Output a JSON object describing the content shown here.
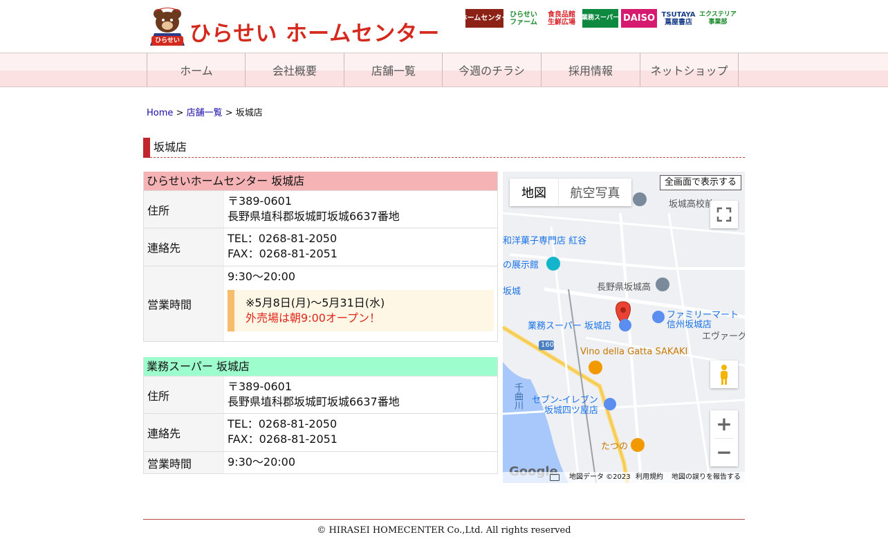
{
  "header": {
    "logo_text": "ひらせい ホームセンター",
    "logo_badge": "ひらせい",
    "banners": [
      {
        "label": "ホームセンター",
        "bg": "#8b2215",
        "color": "#ffffff"
      },
      {
        "label": "ひらせい\nファーム",
        "bg": "#ffffff",
        "color": "#1b8a2b"
      },
      {
        "label": "食良品館\n生鮮広場",
        "bg": "#ffffff",
        "color": "#d8262c"
      },
      {
        "label": "業務スーパー",
        "bg": "#0d8a3f",
        "color": "#ffffff"
      },
      {
        "label": "DAISO",
        "bg": "#d61a6f",
        "color": "#ffffff"
      },
      {
        "label": "TSUTAYA\n蔦屋書店",
        "bg": "#ffffff",
        "color": "#1b3f8a"
      },
      {
        "label": "エクステリア\n事業部",
        "bg": "#ffffff",
        "color": "#1b8a2b"
      }
    ]
  },
  "nav": [
    {
      "label": "ホーム"
    },
    {
      "label": "会社概要"
    },
    {
      "label": "店舗一覧"
    },
    {
      "label": "今週のチラシ"
    },
    {
      "label": "採用情報"
    },
    {
      "label": "ネットショップ"
    }
  ],
  "breadcrumb": {
    "home": "Home",
    "sep1": ">",
    "list": "店舗一覧",
    "sep2": ">",
    "current": "坂城店"
  },
  "page_title": "坂城店",
  "stores": [
    {
      "name": "ひらせいホームセンター 坂城店",
      "head_color": "#f5b3b5",
      "address_label": "住所",
      "postal": "〒389-0601",
      "address": "長野県埴科郡坂城町坂城6637番地",
      "contact_label": "連絡先",
      "tel": "TEL：0268-81-2050",
      "fax": "FAX：0268-81-2051",
      "hours_label": "営業時間",
      "hours": "9:30～20:00",
      "notice_line1": "※5月8日(月)～5月31日(水)",
      "notice_line2": "外売場は朝9:00オープン！"
    },
    {
      "name": "業務スーパー 坂城店",
      "head_color": "#9dfdcd",
      "address_label": "住所",
      "postal": "〒389-0601",
      "address": "長野県埴科郡坂城町坂城6637番地",
      "contact_label": "連絡先",
      "tel": "TEL：0268-81-2050",
      "fax": "FAX：0268-81-2051",
      "hours_label": "営業時間",
      "hours": "9:30～20:00"
    }
  ],
  "map": {
    "type_map": "地図",
    "type_satellite": "航空写真",
    "fullscreen_label": "全画面で表示する",
    "zoom_in": "+",
    "zoom_out": "−",
    "google": "Google",
    "attribution": "地図データ ©2023",
    "terms": "利用規約",
    "report": "地図の誤りを報告する",
    "labels": [
      {
        "text": "坂城高校前",
        "color": "#555555"
      },
      {
        "text": "和洋菓子専門店 紅谷",
        "color": "#1a73e8"
      },
      {
        "text": "の展示館",
        "color": "#1a73e8"
      },
      {
        "text": "長野県坂城高",
        "color": "#555555"
      },
      {
        "text": "坂城",
        "color": "#1a73e8"
      },
      {
        "text": "ファミリーマート",
        "color": "#1a73e8"
      },
      {
        "text": "信州坂城店",
        "color": "#1a73e8"
      },
      {
        "text": "業務スーパー 坂城店",
        "color": "#1a73e8"
      },
      {
        "text": "エヴァーグ",
        "color": "#555555"
      },
      {
        "text": "Vino della Gatta SAKAKI",
        "color": "#c77800"
      },
      {
        "text": "千曲川",
        "color": "#3a6fb0"
      },
      {
        "text": "セブン-イレブン",
        "color": "#1a73e8"
      },
      {
        "text": "坂城四ツ屋店",
        "color": "#1a73e8"
      },
      {
        "text": "たつの",
        "color": "#c77800"
      },
      {
        "text": "160",
        "color": "#ffffff"
      }
    ]
  },
  "footer": {
    "copyright": "© HIRASEI HOMECENTER Co.,Ltd. All rights reserved"
  }
}
